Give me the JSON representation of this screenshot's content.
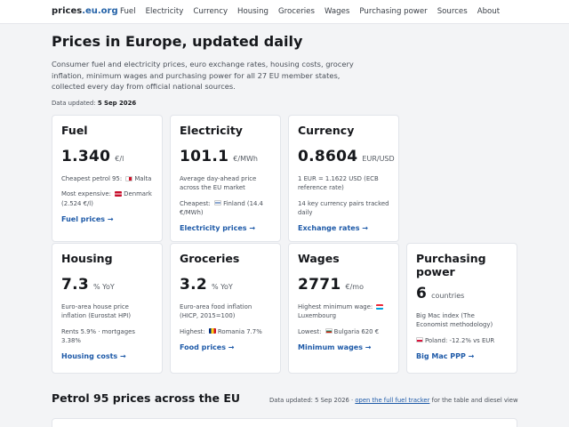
{
  "header": {
    "brand_name": "prices",
    "brand_tld": ".eu.org",
    "nav": [
      "Fuel",
      "Electricity",
      "Currency",
      "Housing",
      "Groceries",
      "Wages",
      "Purchasing power",
      "Sources",
      "About"
    ]
  },
  "page": {
    "title": "Prices in Europe, updated daily",
    "intro": "Consumer fuel and electricity prices, euro exchange rates, housing costs, grocery inflation, minimum wages and purchasing power for all 27 EU member states, collected every day from official national sources.",
    "updated_label": "Data updated:",
    "updated_date": "5 Sep 2026"
  },
  "cards": {
    "fuel": {
      "title": "Fuel",
      "value": "1.340",
      "unit": "€/l",
      "cheapest_label": "Cheapest petrol 95:",
      "cheapest_country": "Malta",
      "expensive_label": "Most expensive:",
      "expensive_country": "Denmark",
      "expensive_value": "(2.524 €/l)",
      "link": "Fuel prices →"
    },
    "electricity": {
      "title": "Electricity",
      "value": "101.1",
      "unit": "€/MWh",
      "note": "Average day-ahead price across the EU market",
      "cheapest_label": "Cheapest:",
      "cheapest_country": "Finland (14.4 €/MWh)",
      "link": "Electricity prices →"
    },
    "currency": {
      "title": "Currency",
      "value": "0.8604",
      "unit": "EUR/USD",
      "note": "1 EUR = 1.1622 USD (ECB reference rate)",
      "note2": "14 key currency pairs tracked daily",
      "link": "Exchange rates →"
    },
    "housing": {
      "title": "Housing",
      "value": "7.3",
      "unit": "% YoY",
      "note": "Euro-area house price inflation (Eurostat HPI)",
      "note2": "Rents 5.9% · mortgages 3.38%",
      "link": "Housing costs →"
    },
    "groceries": {
      "title": "Groceries",
      "value": "3.2",
      "unit": "% YoY",
      "note": "Euro-area food inflation (HICP, 2015=100)",
      "highest_label": "Highest:",
      "highest_country": "Romania 7.7%",
      "link": "Food prices →"
    },
    "wages": {
      "title": "Wages",
      "value": "2771",
      "unit": "€/mo",
      "highest_label": "Highest minimum wage:",
      "highest_country": "Luxembourg",
      "lowest_label": "Lowest:",
      "lowest_country": "Bulgaria 620 €",
      "link": "Minimum wages →"
    },
    "ppp": {
      "title": "Purchasing power",
      "value": "6",
      "unit": "countries",
      "note": "Big Mac index (The Economist methodology)",
      "country": "Poland: -12.2% vs EUR",
      "link": "Big Mac PPP →"
    }
  },
  "section": {
    "title": "Petrol 95 prices across the EU",
    "note_prefix": "Data updated: 5 Sep 2026 ·",
    "note_link": "open the full fuel tracker",
    "note_suffix": "for the table and diesel view"
  },
  "colors": {
    "accent": "#1e5aa8",
    "background": "#f3f4f6",
    "card": "#ffffff"
  }
}
